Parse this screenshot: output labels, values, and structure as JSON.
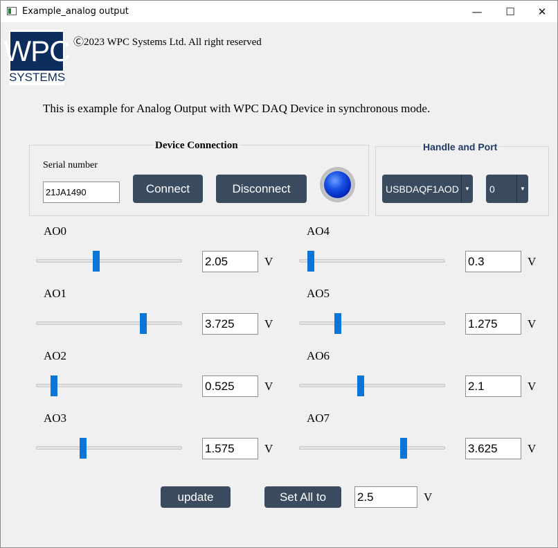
{
  "window": {
    "title": "Example_analog output",
    "minimize": "—",
    "maximize": "☐",
    "close": "✕"
  },
  "logo": {
    "line1": "WPC",
    "line2": "SYSTEMS"
  },
  "copyright": "Ⓒ2023 WPC Systems Ltd. All right reserved",
  "description": "This is example for Analog Output with WPC DAQ Device in synchronous mode.",
  "device_connection": {
    "title": "Device Connection",
    "serial_label": "Serial number",
    "serial_value": "21JA1490",
    "connect_label": "Connect",
    "disconnect_label": "Disconnect",
    "led_color": "#0a3ee0"
  },
  "handle_port": {
    "title": "Handle and Port",
    "title_color": "#1f3a68",
    "handle_value": "USBDAQF1AOD",
    "port_value": "0"
  },
  "slider_range": [
    0,
    5
  ],
  "channels": [
    {
      "label": "AO0",
      "value": "2.05",
      "level": 2.05,
      "unit": "V"
    },
    {
      "label": "AO1",
      "value": "3.725",
      "level": 3.725,
      "unit": "V"
    },
    {
      "label": "AO2",
      "value": "0.525",
      "level": 0.525,
      "unit": "V"
    },
    {
      "label": "AO3",
      "value": "1.575",
      "level": 1.575,
      "unit": "V"
    },
    {
      "label": "AO4",
      "value": "0.3",
      "level": 0.3,
      "unit": "V"
    },
    {
      "label": "AO5",
      "value": "1.275",
      "level": 1.275,
      "unit": "V"
    },
    {
      "label": "AO6",
      "value": "2.1",
      "level": 2.1,
      "unit": "V"
    },
    {
      "label": "AO7",
      "value": "3.625",
      "level": 3.625,
      "unit": "V"
    }
  ],
  "actions": {
    "update_label": "update",
    "set_all_label": "Set All to",
    "set_all_value": "2.5",
    "set_all_unit": "V"
  },
  "colors": {
    "button_bg": "#3a4b5f",
    "slider_handle": "#0a74d8"
  }
}
